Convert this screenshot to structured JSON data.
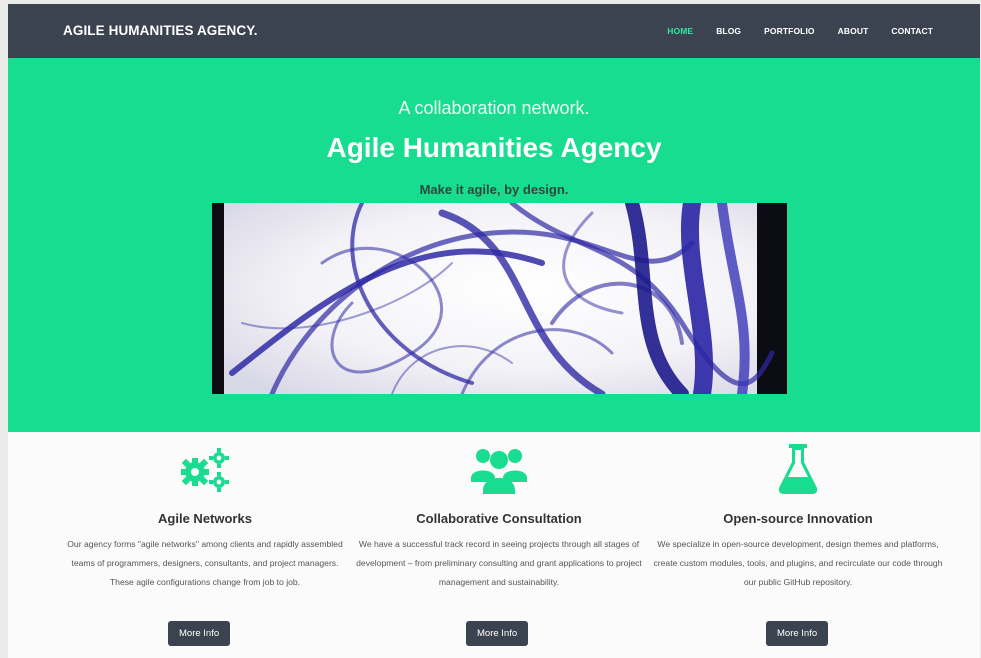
{
  "brand": "AGILE HUMANITIES AGENCY.",
  "nav": [
    {
      "label": "HOME",
      "active": true
    },
    {
      "label": "BLOG",
      "active": false
    },
    {
      "label": "PORTFOLIO",
      "active": false
    },
    {
      "label": "ABOUT",
      "active": false
    },
    {
      "label": "CONTACT",
      "active": false
    }
  ],
  "hero": {
    "tagline": "A collaboration network.",
    "title": "Agile Humanities Agency",
    "subtitle": "Make it agile, by design."
  },
  "features": [
    {
      "icon": "gears-icon",
      "title": "Agile Networks",
      "text": "Our agency forms \"agile networks\" among clients and rapidly assembled teams of programmers, designers, consultants, and project managers. These agile configurations change from job to job.",
      "button": "More Info"
    },
    {
      "icon": "users-icon",
      "title": "Collaborative Consultation",
      "text": "We have a successful track record in seeing projects through all stages of development – from preliminary consulting and grant applications to project management and sustainability.",
      "button": "More Info"
    },
    {
      "icon": "flask-icon",
      "title": "Open-source Innovation",
      "text": "We specialize in open-source development, design themes and platforms, create custom modules, tools, and plugins, and recirculate our code through our public GitHub repository.",
      "button": "More Info"
    }
  ],
  "colors": {
    "navbar": "#3b4350",
    "accent": "#18dc8f",
    "nav_active": "#2ee8a1",
    "button": "#3b4350"
  }
}
